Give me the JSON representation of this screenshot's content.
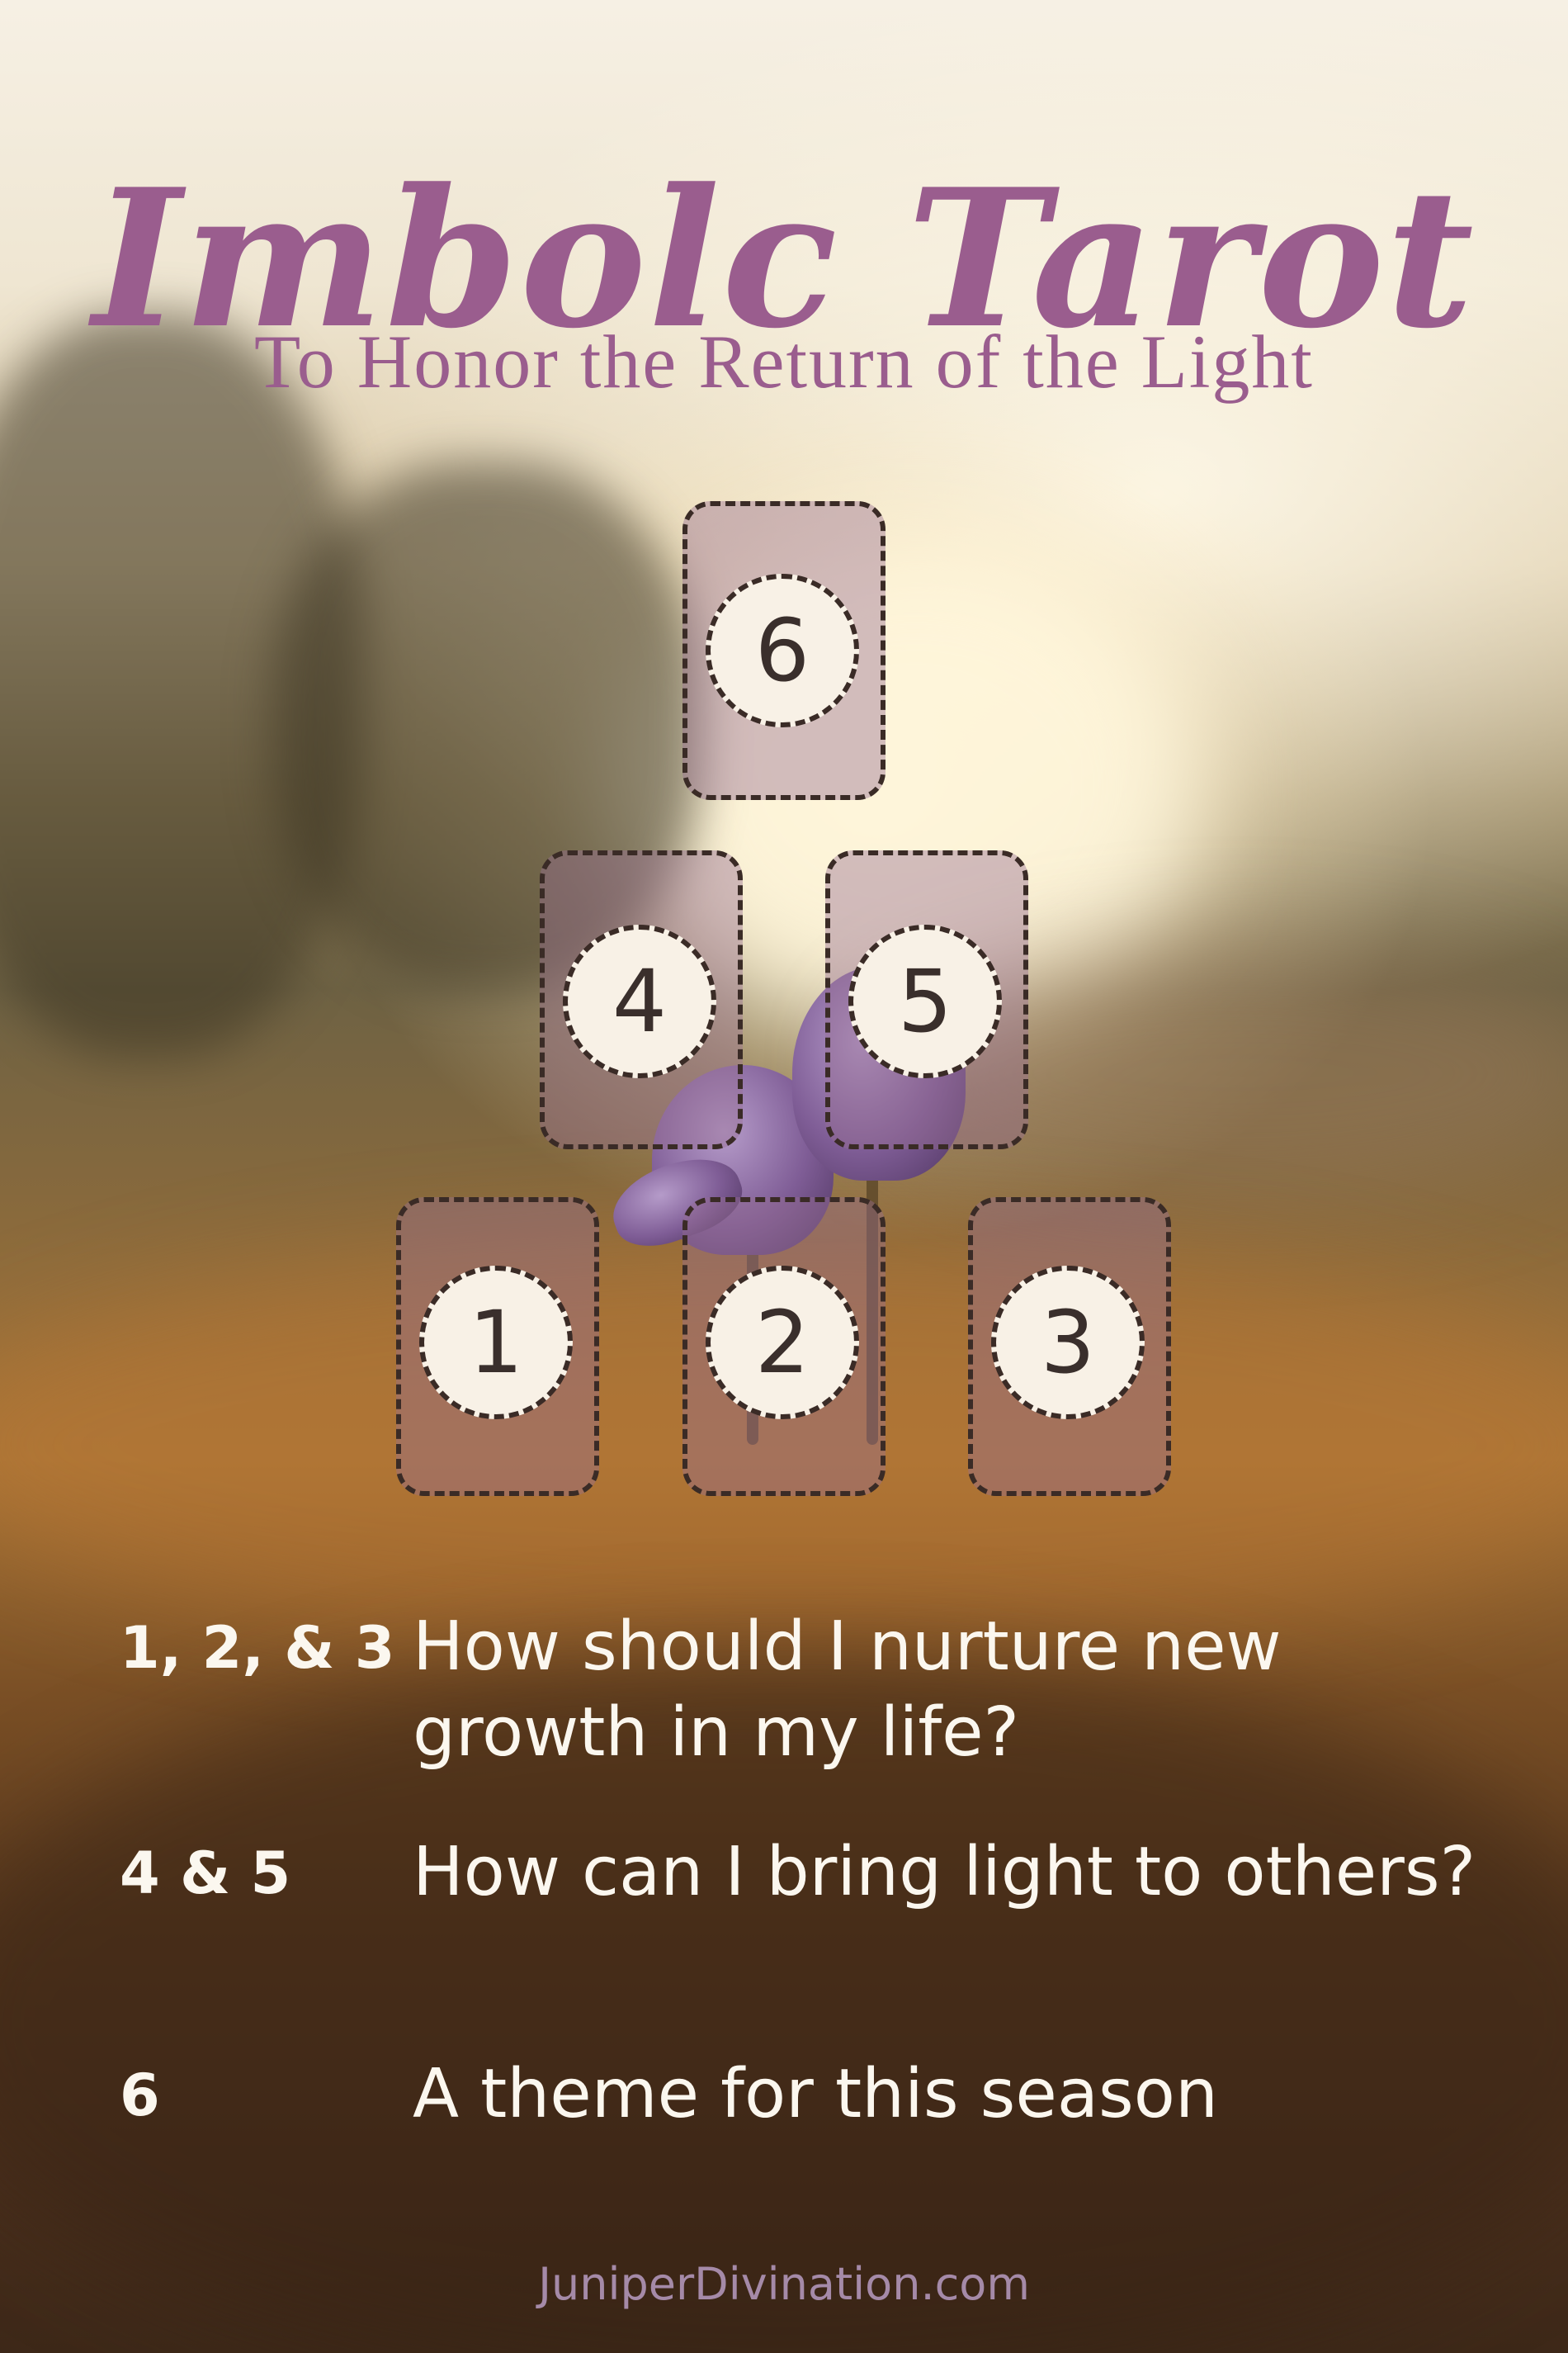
{
  "header": {
    "title": "Imbolc Tarot",
    "subtitle": "To Honor the Return of the Light"
  },
  "spread": {
    "positions": [
      "1",
      "2",
      "3",
      "4",
      "5",
      "6"
    ]
  },
  "legend": [
    {
      "key": "1, 2, & 3",
      "text": "How should I nurture new growth in my life?"
    },
    {
      "key": "4 & 5",
      "text": "How can I bring light to others?"
    },
    {
      "key": "6",
      "text": "A theme for this season"
    }
  ],
  "footer": {
    "site": "JuniperDivination.com"
  },
  "colors": {
    "title": "#9a5d8e",
    "card_fill": "#966e91",
    "badge_fill": "#f8f1e6",
    "outline": "#3a2b26",
    "legend_text": "#fbf7ef"
  }
}
